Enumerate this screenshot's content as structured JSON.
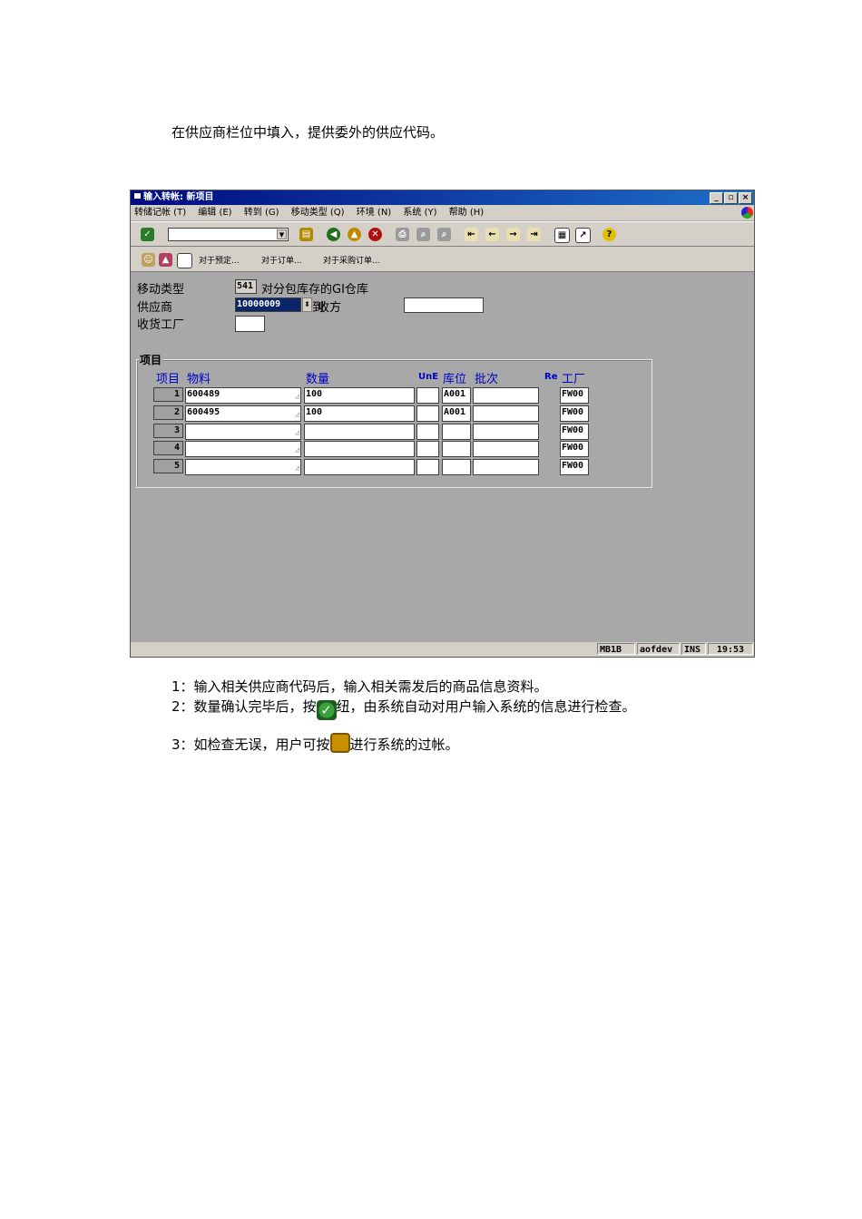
{
  "intro": "在供应商栏位中填入，提供委外的供应代码。",
  "window": {
    "title": "输入转帐: 新项目",
    "menu": [
      "转储记帐 (T)",
      "编辑 (E)",
      "转到 (G)",
      "移动类型 (Q)",
      "环境 (N)",
      "系统 (Y)",
      "帮助 (H)"
    ],
    "app_toolbar": [
      "对于预定...",
      "对于订单...",
      "对于采购订单..."
    ],
    "header": {
      "move_type_label": "移动类型",
      "move_type_code": "541",
      "move_type_text": "对分包库存的GI仓库",
      "vendor_label": "供应商",
      "vendor_value": "10000009",
      "recipient_label": "收方",
      "recipient_prefix": "到",
      "plant_label": "收货工厂"
    },
    "items_group": {
      "title": "项目",
      "columns": {
        "item": "项目",
        "material": "物料",
        "qty": "数量",
        "une": "UnE",
        "sloc": "库位",
        "batch": "批次",
        "re": "Re",
        "plant": "工厂"
      },
      "rows": [
        {
          "num": "1",
          "material": "600489",
          "qty": "100",
          "sloc": "A001",
          "plant": "FW00"
        },
        {
          "num": "2",
          "material": "600495",
          "qty": "100",
          "sloc": "A001",
          "plant": "FW00"
        },
        {
          "num": "3",
          "material": "",
          "qty": "",
          "sloc": "",
          "plant": "FW00"
        },
        {
          "num": "4",
          "material": "",
          "qty": "",
          "sloc": "",
          "plant": "FW00"
        },
        {
          "num": "5",
          "material": "",
          "qty": "",
          "sloc": "",
          "plant": "FW00"
        }
      ]
    },
    "status": {
      "tcode": "MB1B",
      "server": "aofdev",
      "mode": "INS",
      "time": "19:53"
    }
  },
  "notes": {
    "n1": "1：输入相关供应商代码后，输入相关需发后的商品信息资料。",
    "n2_before": "2：数量确认完毕后，按",
    "n2_after": "纽，由系统自动对用户输入系统的信息进行检查。",
    "n3_before": "3：如检查无误，用户可按",
    "n3_after": "进行系统的过帐。"
  },
  "icons": [
    "check-icon",
    "save-icon",
    "back-icon",
    "exit-icon",
    "cancel-icon",
    "print-icon",
    "find-icon",
    "help-icon"
  ]
}
